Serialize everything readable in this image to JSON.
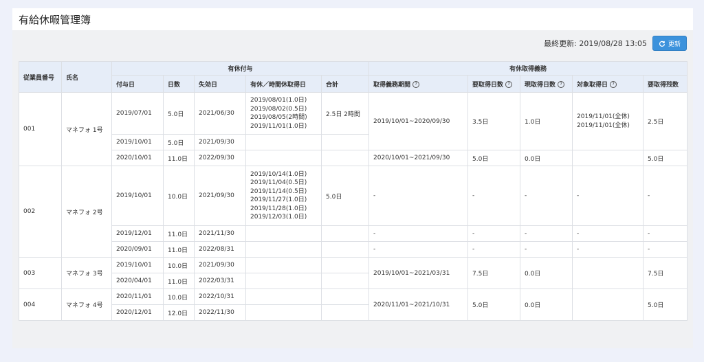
{
  "page": {
    "title": "有給休暇管理簿"
  },
  "toolbar": {
    "last_updated": "最終更新: 2019/08/28 13:05",
    "update_button": "更新"
  },
  "headers": {
    "employee_no": "従業員番号",
    "name": "氏名",
    "group_grant": "有休付与",
    "group_obligation": "有休取得義務",
    "grant_date": "付与日",
    "days": "日数",
    "expiry_date": "失効日",
    "leave_dates": "有休／時間休取得日",
    "total": "合計",
    "obligation_period": "取得義務期間",
    "required_days": "要取得日数",
    "current_days": "現取得日数",
    "target_dates": "対象取得日",
    "remaining_days": "要取得残数"
  },
  "rows": {
    "e1": {
      "emp_no": "001",
      "name": "マネフォ 1号",
      "g1": {
        "grant": "2019/07/01",
        "days": "5.0日",
        "expiry": "2021/06/30",
        "leave": [
          "2019/08/01(1.0日)",
          "2019/08/02(0.5日)",
          "2019/08/05(2時間)",
          "2019/11/01(1.0日)"
        ],
        "total": "2.5日 2時間"
      },
      "g2": {
        "grant": "2019/10/01",
        "days": "5.0日",
        "expiry": "2021/09/30"
      },
      "g3": {
        "grant": "2020/10/01",
        "days": "11.0日",
        "expiry": "2022/09/30"
      },
      "ob1": {
        "period": "2019/10/01~2020/09/30",
        "required": "3.5日",
        "current": "1.0日",
        "targets": [
          "2019/11/01(全休)",
          "2019/11/01(全休)"
        ],
        "remaining": "2.5日"
      },
      "ob2": {
        "period": "2020/10/01~2021/09/30",
        "required": "5.0日",
        "current": "0.0日",
        "remaining": "5.0日"
      }
    },
    "e2": {
      "emp_no": "002",
      "name": "マネフォ 2号",
      "g1": {
        "grant": "2019/10/01",
        "days": "10.0日",
        "expiry": "2021/09/30",
        "leave": [
          "2019/10/14(1.0日)",
          "2019/11/04(0.5日)",
          "2019/11/14(0.5日)",
          "2019/11/27(1.0日)",
          "2019/11/28(1.0日)",
          "2019/12/03(1.0日)"
        ],
        "total": "5.0日"
      },
      "g2": {
        "grant": "2019/12/01",
        "days": "11.0日",
        "expiry": "2021/11/30"
      },
      "g3": {
        "grant": "2020/09/01",
        "days": "11.0日",
        "expiry": "2022/08/31"
      },
      "dash": "-"
    },
    "e3": {
      "emp_no": "003",
      "name": "マネフォ 3号",
      "g1": {
        "grant": "2019/10/01",
        "days": "10.0日",
        "expiry": "2021/09/30"
      },
      "g2": {
        "grant": "2020/04/01",
        "days": "11.0日",
        "expiry": "2022/03/31"
      },
      "ob": {
        "period": "2019/10/01~2021/03/31",
        "required": "7.5日",
        "current": "0.0日",
        "remaining": "7.5日"
      }
    },
    "e4": {
      "emp_no": "004",
      "name": "マネフォ 4号",
      "g1": {
        "grant": "2020/11/01",
        "days": "10.0日",
        "expiry": "2022/10/31"
      },
      "g2": {
        "grant": "2020/12/01",
        "days": "12.0日",
        "expiry": "2022/11/30"
      },
      "ob": {
        "period": "2020/11/01~2021/10/31",
        "required": "5.0日",
        "current": "0.0日",
        "remaining": "5.0日"
      }
    }
  },
  "colors": {
    "header_bg": "#e6edf8",
    "button": "#3c92dc",
    "border": "#dcdfe4"
  },
  "icons": {
    "refresh": "refresh-icon",
    "help": "question-circle-icon",
    "help_glyph": "?"
  }
}
